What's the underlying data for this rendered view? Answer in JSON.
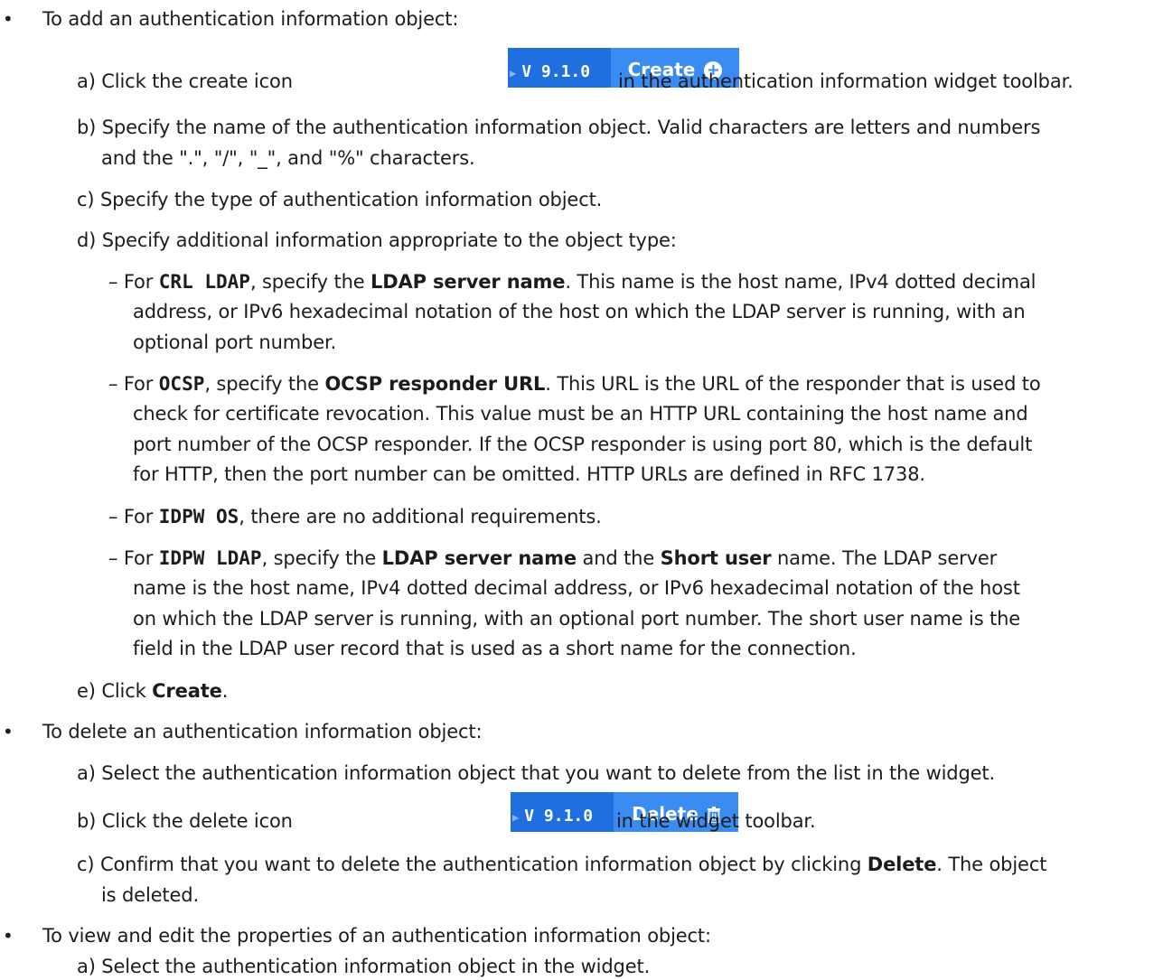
{
  "bullets": [
    "To add an authentication information object:",
    "To delete an authentication information object:",
    "To view and edit the properties of an authentication information object:"
  ],
  "add": {
    "a": {
      "pre": "a) Click the create icon",
      "post": "in the authentication information widget toolbar."
    },
    "b": [
      "b) Specify the name of the authentication information object. Valid characters are letters and numbers",
      "and the \".\", \"/\", \"_\", and \"%\" characters."
    ],
    "c": "c) Specify the type of authentication information object.",
    "d": "d) Specify additional information appropriate to the object type:",
    "crl": {
      "l1_pre": "– For",
      "l1_code": "CRL LDAP",
      "l1_mid": ", specify the",
      "l1_bold": "LDAP server name",
      "l1_post": ". This name is the host name, IPv4 dotted decimal",
      "l2": "address, or IPv6 hexadecimal notation of the host on which the LDAP server is running, with an",
      "l3": "optional port number."
    },
    "ocsp": {
      "l1_pre": "– For",
      "l1_code": "OCSP",
      "l1_mid": ", specify the",
      "l1_bold": "OCSP responder URL",
      "l1_post": ". This URL is the URL of the responder that is used to",
      "l2": "check for certificate revocation. This value must be an HTTP URL containing the host name and",
      "l3": "port number of the OCSP responder. If the OCSP responder is using port 80, which is the default",
      "l4": "for HTTP, then the port number can be omitted. HTTP URLs are defined in RFC 1738."
    },
    "idpwos": {
      "l1_pre": "– For",
      "l1_code": "IDPW OS",
      "l1_post": ", there are no additional requirements."
    },
    "idpwldap": {
      "l1_pre": "– For",
      "l1_code": "IDPW LDAP",
      "l1_mid": ", specify the",
      "l1_bold1": "LDAP server name",
      "l1_and": "and the",
      "l1_bold2": "Short user",
      "l1_post": "name. The LDAP server",
      "l2": "name is the host name, IPv4 dotted decimal address, or IPv6 hexadecimal notation of the host",
      "l3": "on which the LDAP server is running, with an optional port number. The short user name is the",
      "l4": "field in the LDAP user record that is used as a short name for the connection."
    },
    "e": {
      "pre": "e) Click",
      "bold": "Create",
      "post": "."
    }
  },
  "delete": {
    "a": "a) Select the authentication information object that you want to delete from the list in the widget.",
    "b": {
      "pre": "b) Click the delete icon",
      "post": "in the widget toolbar."
    },
    "c": {
      "pre": "c) Confirm that you want to delete the authentication information object by clicking",
      "bold": "Delete",
      "post": ". The object",
      "l2": "is deleted."
    }
  },
  "view": {
    "a": "a) Select the authentication information object in the widget."
  },
  "toolbar": {
    "version": "V 9.1.0",
    "create_label": "Create",
    "delete_label": "Delete",
    "accent": "#3a8bf2",
    "version_bg": "#1f6fe0",
    "create_icon": "plus-circle-icon",
    "delete_icon": "trash-icon"
  }
}
